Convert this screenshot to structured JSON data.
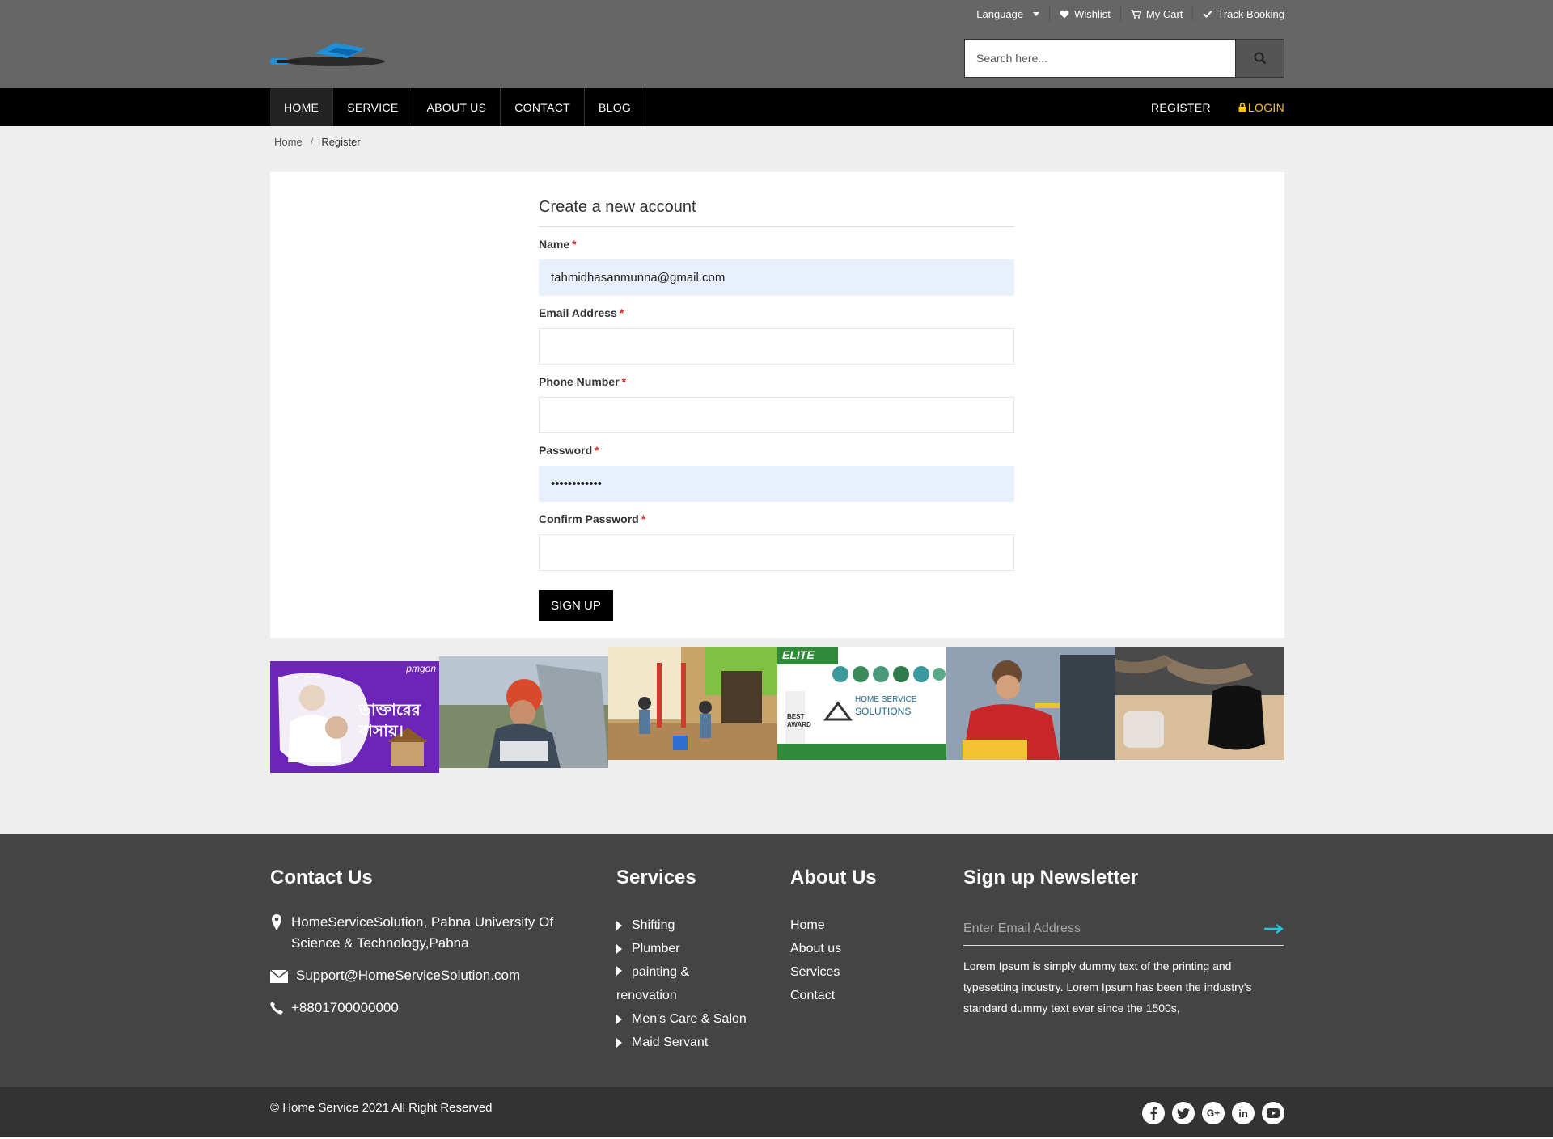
{
  "header": {
    "top_links": {
      "language": "Language",
      "wishlist": "Wishlist",
      "cart": "My Cart",
      "track": "Track Booking"
    },
    "search_placeholder": "Search here..."
  },
  "nav": {
    "items": [
      "HOME",
      "SERVICE",
      "ABOUT US",
      "CONTACT",
      "BLOG"
    ],
    "register": "REGISTER",
    "login": "LOGIN"
  },
  "breadcrumb": {
    "home": "Home",
    "separator": "/",
    "current": "Register"
  },
  "form": {
    "title": "Create a new account",
    "required_mark": "*",
    "fields": {
      "name": {
        "label": "Name",
        "value": "tahmidhasanmunna@gmail.com"
      },
      "email": {
        "label": "Email Address",
        "value": ""
      },
      "phone": {
        "label": "Phone Number",
        "value": ""
      },
      "password": {
        "label": "Password",
        "value": "••••••••••••"
      },
      "confirm": {
        "label": "Confirm Password",
        "value": ""
      }
    },
    "submit_label": "SIGN UP"
  },
  "gallery": {
    "banner1_text": "ডাক্তারের বাসায়।",
    "banner1_brand": "pmgon",
    "banner4_brand": "ELITE",
    "banner4_text1": "HOME SERVICE",
    "banner4_text2": "SOLUTIONS",
    "banner4_award": "BEST AWARD"
  },
  "footer": {
    "contact": {
      "title": "Contact Us",
      "address": "HomeServiceSolution, Pabna University Of Science & Technology,Pabna",
      "email": "Support@HomeServiceSolution.com",
      "phone": "+8801700000000"
    },
    "services": {
      "title": "Services",
      "items": [
        "Shifting",
        "Plumber",
        "painting & renovation",
        "Men's Care & Salon",
        "Maid Servant"
      ]
    },
    "about": {
      "title": "About Us",
      "items": [
        "Home",
        "About us",
        "Services",
        "Contact"
      ]
    },
    "newsletter": {
      "title": "Sign up Newsletter",
      "placeholder": "Enter Email Address",
      "text": "Lorem Ipsum is simply dummy text of the printing and typesetting industry. Lorem Ipsum has been the industry's standard dummy text ever since the 1500s,"
    },
    "copyright": "© Home Service 2021 All Right Reserved",
    "social": [
      "facebook-icon",
      "twitter-icon",
      "google-plus-icon",
      "linkedin-icon",
      "youtube-icon"
    ]
  },
  "colors": {
    "header_bg": "#666666",
    "nav_bg": "#000000",
    "login_accent": "#f3c316",
    "footer_bg": "#444444",
    "bottom_bar_bg": "#333333",
    "autofill_bg": "#e8f0fe",
    "required": "#d9231d",
    "newsletter_arrow": "#1fc8e0"
  }
}
